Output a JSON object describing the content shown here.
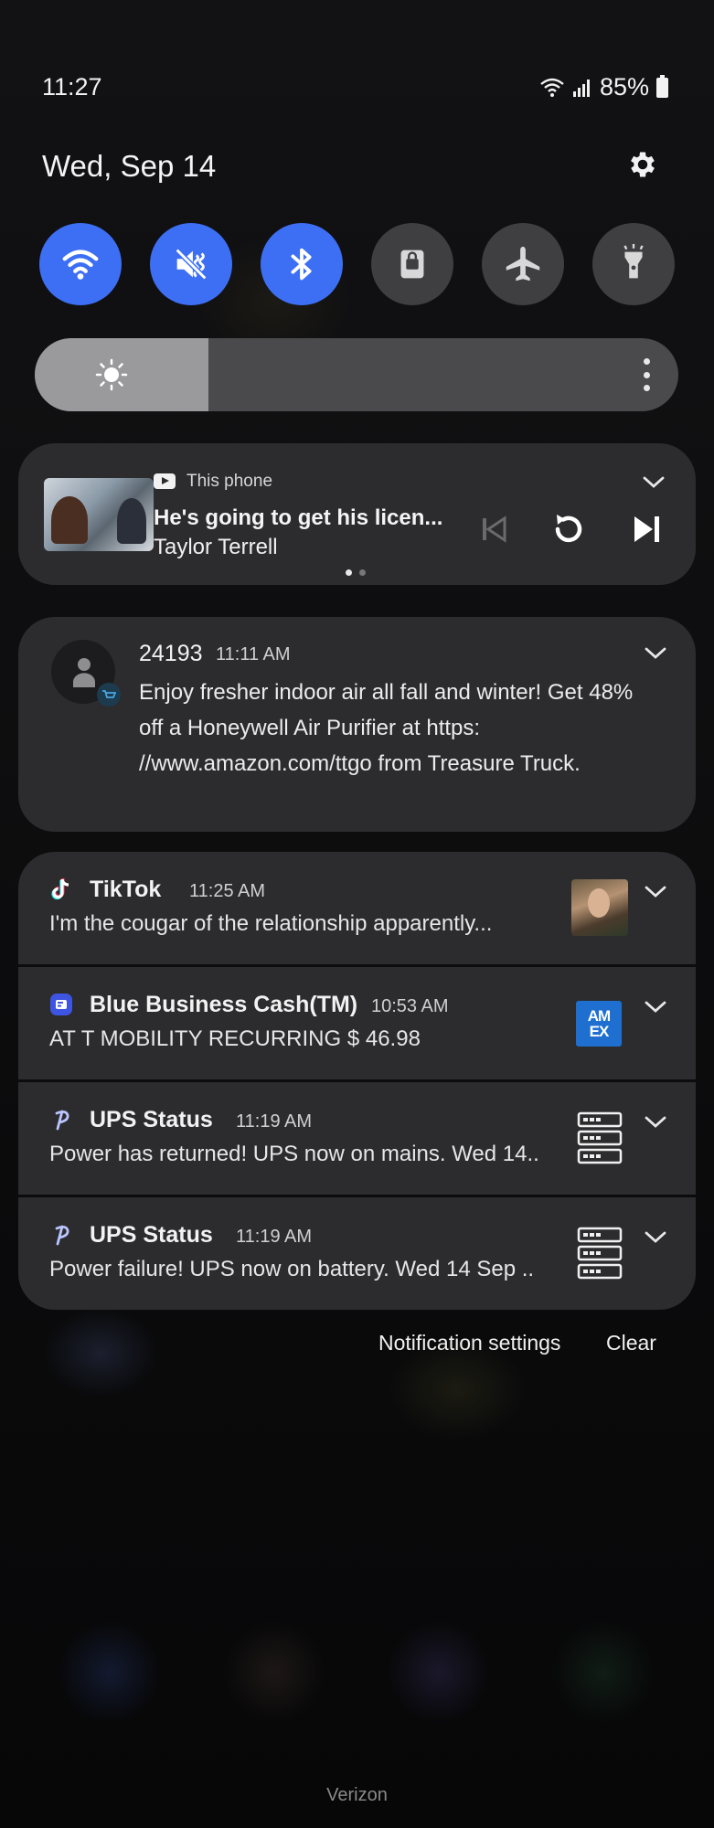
{
  "status_bar": {
    "time": "11:27",
    "battery": "85%"
  },
  "header": {
    "date": "Wed, Sep 14"
  },
  "quick_settings": [
    {
      "name": "Wi-Fi",
      "icon": "wifi-icon",
      "state": "on"
    },
    {
      "name": "Mute",
      "icon": "mute-icon",
      "state": "on"
    },
    {
      "name": "Bluetooth",
      "icon": "bluetooth-icon",
      "state": "on"
    },
    {
      "name": "Screen lock",
      "icon": "lock-icon",
      "state": "off"
    },
    {
      "name": "Airplane mode",
      "icon": "airplane-icon",
      "state": "off"
    },
    {
      "name": "Flashlight",
      "icon": "flashlight-icon",
      "state": "off"
    }
  ],
  "brightness": {
    "level": 0.27
  },
  "media": {
    "source": "This phone",
    "title": "He's going to get his licen...",
    "artist": "Taylor Terrell"
  },
  "message": {
    "sender": "24193",
    "time": "11:11 AM",
    "body": "Enjoy fresher indoor air all fall and winter! Get 48% off a Honeywell Air Purifier at https: //www.amazon.com/ttgo from Treasure Truck."
  },
  "notifications": [
    {
      "app": "TikTok",
      "time": "11:25 AM",
      "text": "I'm the cougar of the relationship apparently..."
    },
    {
      "app": "Blue Business Cash(TM)",
      "time": "10:53 AM",
      "text": "AT T MOBILITY RECURRING $ 46.98",
      "badge": "AM EX"
    },
    {
      "app": "UPS Status",
      "time": "11:19 AM",
      "text": "Power has returned! UPS now on mains. Wed 14.."
    },
    {
      "app": "UPS Status",
      "time": "11:19 AM",
      "text": "Power failure! UPS now on battery. Wed 14 Sep .."
    }
  ],
  "actions": {
    "settings": "Notification settings",
    "clear": "Clear"
  },
  "carrier": "Verizon",
  "colors": {
    "accent": "#3d6ff5",
    "card": "#2c2c2e",
    "toggle_off": "#3f3f41"
  }
}
